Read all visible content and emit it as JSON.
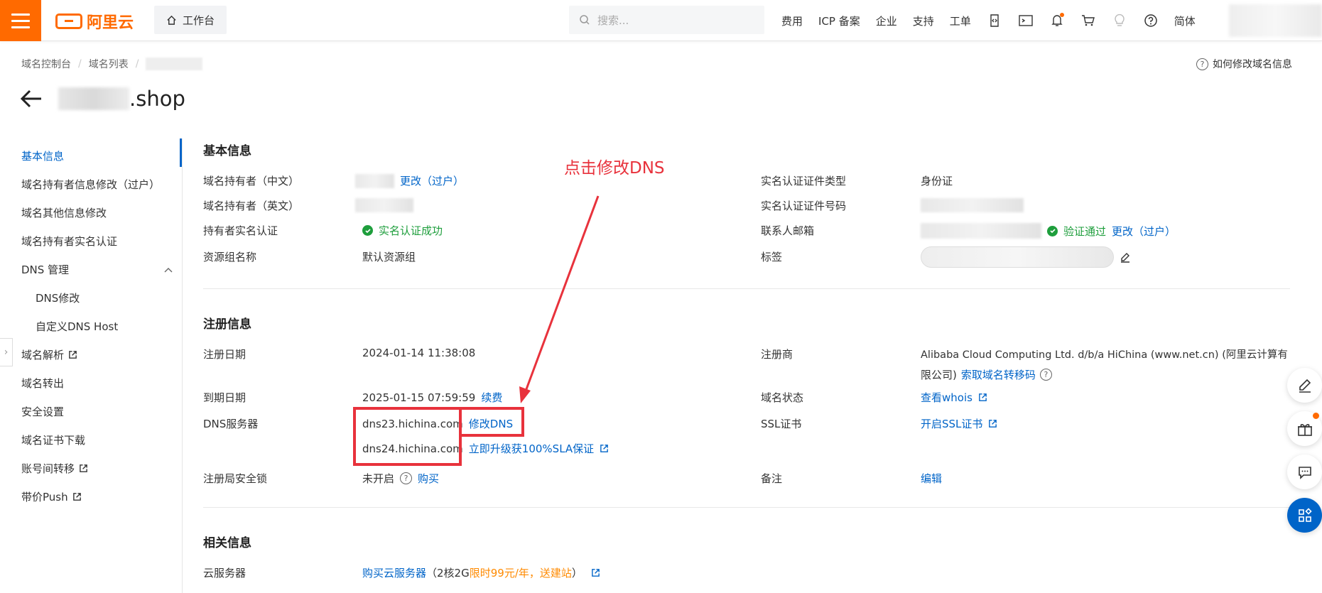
{
  "topbar": {
    "brand": "阿里云",
    "workbench": "工作台",
    "search_placeholder": "搜索...",
    "nav": [
      "费用",
      "ICP 备案",
      "企业",
      "支持",
      "工单"
    ],
    "lang": "简体"
  },
  "breadcrumb": [
    "域名控制台",
    "域名列表"
  ],
  "help_link": "如何修改域名信息",
  "title": ".shop",
  "sidebar": {
    "items": [
      "基本信息",
      "域名持有者信息修改（过户）",
      "域名其他信息修改",
      "域名持有者实名认证",
      "DNS 管理",
      "DNS修改",
      "自定义DNS Host",
      "域名解析",
      "域名转出",
      "安全设置",
      "域名证书下载",
      "账号间转移",
      "带价Push"
    ]
  },
  "basic": {
    "title": "基本信息",
    "owner_cn_label": "域名持有者（中文）",
    "owner_cn_change": "更改（过户）",
    "owner_en_label": "域名持有者（英文）",
    "realname_label": "持有者实名认证",
    "realname_value": "实名认证成功",
    "group_label": "资源组名称",
    "group_value": "默认资源组",
    "cert_type_label": "实名认证证件类型",
    "cert_type_value": "身份证",
    "cert_no_label": "实名认证证件号码",
    "email_label": "联系人邮箱",
    "email_status": "验证通过",
    "email_change": "更改（过户）",
    "tag_label": "标签"
  },
  "reg": {
    "title": "注册信息",
    "reg_date_label": "注册日期",
    "reg_date": "2024-01-14 11:38:08",
    "exp_date_label": "到期日期",
    "exp_date": "2025-01-15 07:59:59",
    "renew": "续费",
    "dns_label": "DNS服务器",
    "dns1": "dns23.hichina.com",
    "dns2": "dns24.hichina.com",
    "modify_dns": "修改DNS",
    "upgrade": "立即升级获100%SLA保证",
    "lock_label": "注册局安全锁",
    "lock_value": "未开启",
    "buy": "购买",
    "registrar_label": "注册商",
    "registrar_line1": "Alibaba Cloud Computing Ltd. d/b/a HiChina (www.net.cn) (阿里云计算有",
    "registrar_line2": "限公司)",
    "transfer_code": "索取域名转移码",
    "status_label": "域名状态",
    "whois": "查看whois",
    "ssl_label": "SSL证书",
    "ssl_link": "开启SSL证书",
    "note_label": "备注",
    "edit": "编辑"
  },
  "related": {
    "title": "相关信息",
    "server_label": "云服务器",
    "buy_server": "购买云服务器",
    "spec_prefix": "（2核2G",
    "promo": "限时99元/年，送建站",
    "spec_suffix": "）"
  },
  "annotation": "点击修改DNS",
  "colors": {
    "accent": "#ff6a00",
    "link": "#0064c8",
    "success": "#1e9e3c",
    "annotation": "#e8323c"
  }
}
